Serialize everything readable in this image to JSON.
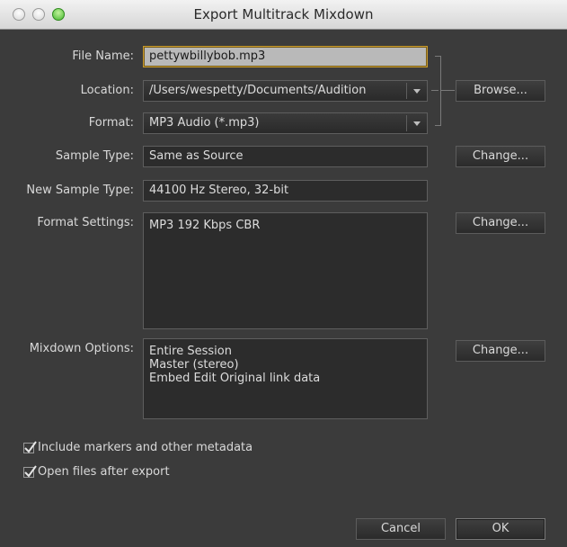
{
  "window": {
    "title": "Export Multitrack Mixdown"
  },
  "form": {
    "file_name_label": "File Name:",
    "file_name_value": "pettywbillybob.mp3",
    "location_label": "Location:",
    "location_value": "/Users/wespetty/Documents/Audition",
    "format_label": "Format:",
    "format_value": "MP3 Audio (*.mp3)",
    "sample_type_label": "Sample Type:",
    "sample_type_value": "Same as Source",
    "new_sample_type_label": "New Sample Type:",
    "new_sample_type_value": "44100 Hz Stereo, 32-bit",
    "format_settings_label": "Format Settings:",
    "format_settings_value": "MP3 192 Kbps CBR",
    "mixdown_options_label": "Mixdown Options:",
    "mixdown_options_lines": [
      "Entire Session",
      "Master (stereo)",
      "Embed Edit Original link data"
    ]
  },
  "buttons": {
    "browse": "Browse...",
    "change_sample_type": "Change...",
    "change_format_settings": "Change...",
    "change_mixdown": "Change...",
    "cancel": "Cancel",
    "ok": "OK"
  },
  "checkboxes": [
    {
      "label": "Include markers and other metadata",
      "checked": true
    },
    {
      "label": "Open files after export",
      "checked": true
    }
  ],
  "colors": {
    "dialog_background": "#3b3b3b",
    "focus_ring": "#c79a2e",
    "zoom_button": "#46b830"
  }
}
